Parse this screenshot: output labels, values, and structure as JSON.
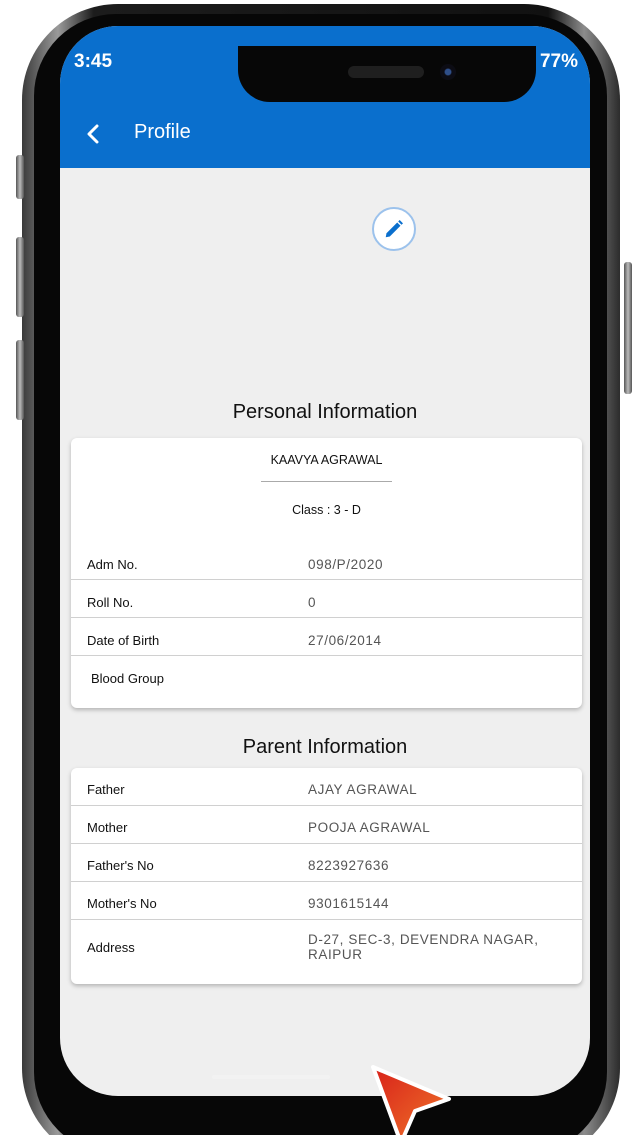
{
  "status_bar": {
    "time": "3:45",
    "battery": "77%"
  },
  "app_bar": {
    "title": "Profile",
    "back_icon": "chevron-left-icon",
    "color": "#0a6fcd"
  },
  "edit_icon": "pencil-icon",
  "personal": {
    "heading": "Personal Information",
    "name": "KAAVYA AGRAWAL",
    "class_text": "Class : 3 - D",
    "rows": [
      {
        "label": "Adm No.",
        "value": "098/P/2020"
      },
      {
        "label": "Roll No.",
        "value": "0"
      },
      {
        "label": "Date of Birth",
        "value": "27/06/2014"
      },
      {
        "label": "Blood Group",
        "value": ""
      }
    ]
  },
  "parent": {
    "heading": "Parent Information",
    "rows": [
      {
        "label": "Father",
        "value": "AJAY AGRAWAL"
      },
      {
        "label": "Mother",
        "value": "POOJA AGRAWAL"
      },
      {
        "label": "Father's No",
        "value": "8223927636"
      },
      {
        "label": "Mother's No",
        "value": "9301615144"
      },
      {
        "label": "Address",
        "value": "D-27, SEC-3, DEVENDRA NAGAR, RAIPUR"
      }
    ]
  }
}
